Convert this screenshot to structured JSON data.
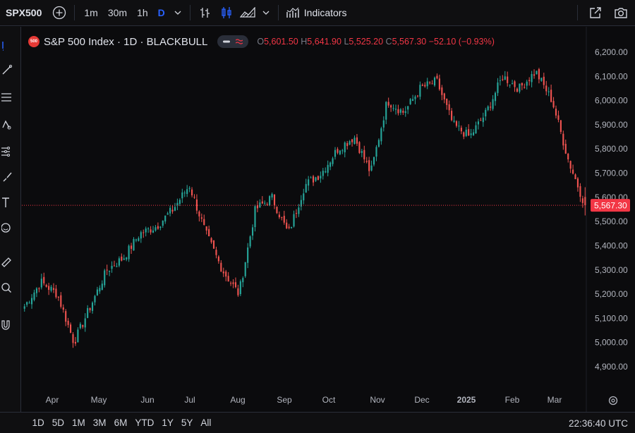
{
  "toolbar": {
    "symbol": "SPX500",
    "timeframes": [
      "1m",
      "30m",
      "1h",
      "D"
    ],
    "indicators_label": "Indicators"
  },
  "legend": {
    "logo_text": "500",
    "title": "S&P 500 Index · 1D · BLACKBULL",
    "open_label": "O",
    "open": "5,601.50",
    "high_label": "H",
    "high": "5,641.90",
    "low_label": "L",
    "low": "5,525.20",
    "close_label": "C",
    "close": "5,567.30",
    "change": "−52.10 (−0.93%)"
  },
  "colors": {
    "up": "#26a69a",
    "down": "#ef5350",
    "background": "#0b0b0d",
    "accent": "#2962ff",
    "last_price_label": "#f23645"
  },
  "price_axis": {
    "ticks": [
      "6,200.00",
      "6,100.00",
      "6,000.00",
      "5,900.00",
      "5,800.00",
      "5,700.00",
      "5,600.00",
      "5,500.00",
      "5,400.00",
      "5,300.00",
      "5,200.00",
      "5,100.00",
      "5,000.00",
      "4,900.00"
    ],
    "last_price": "5,567.30"
  },
  "time_axis": {
    "labels": [
      "Apr",
      "May",
      "Jun",
      "Jul",
      "Aug",
      "Sep",
      "Oct",
      "Nov",
      "Dec",
      "2025",
      "Feb",
      "Mar"
    ]
  },
  "bottom": {
    "ranges": [
      "1D",
      "5D",
      "1M",
      "3M",
      "6M",
      "YTD",
      "1Y",
      "5Y",
      "All"
    ],
    "clock": "22:36:40 UTC"
  },
  "chart_data": {
    "type": "candlestick",
    "ylim": [
      4850,
      6240
    ],
    "grid": false,
    "x_labels": [
      "Apr",
      "May",
      "Jun",
      "Jul",
      "Aug",
      "Sep",
      "Oct",
      "Nov",
      "Dec",
      "2025",
      "Feb",
      "Mar"
    ],
    "close_path_approx": [
      [
        "Apr",
        5150
      ],
      [
        "Apr",
        5250
      ],
      [
        "Apr",
        5200
      ],
      [
        "May",
        5000
      ],
      [
        "May",
        5150
      ],
      [
        "May",
        5300
      ],
      [
        "Jun",
        5350
      ],
      [
        "Jun",
        5450
      ],
      [
        "Jun",
        5480
      ],
      [
        "Jul",
        5550
      ],
      [
        "Jul",
        5650
      ],
      [
        "Jul",
        5450
      ],
      [
        "Aug",
        5300
      ],
      [
        "Aug",
        5200
      ],
      [
        "Aug",
        5550
      ],
      [
        "Sep",
        5600
      ],
      [
        "Sep",
        5450
      ],
      [
        "Sep",
        5650
      ],
      [
        "Oct",
        5700
      ],
      [
        "Oct",
        5800
      ],
      [
        "Oct",
        5850
      ],
      [
        "Nov",
        5700
      ],
      [
        "Nov",
        6000
      ],
      [
        "Nov",
        5950
      ],
      [
        "Dec",
        6050
      ],
      [
        "Dec",
        6080
      ],
      [
        "Dec",
        5900
      ],
      [
        "2025",
        5850
      ],
      [
        "2025",
        5950
      ],
      [
        "2025",
        6100
      ],
      [
        "Feb",
        6050
      ],
      [
        "Feb",
        6120
      ],
      [
        "Feb",
        6000
      ],
      [
        "Mar",
        5750
      ],
      [
        "Mar",
        5567.3
      ]
    ],
    "last": {
      "open": 5601.5,
      "high": 5641.9,
      "low": 5525.2,
      "close": 5567.3
    }
  }
}
